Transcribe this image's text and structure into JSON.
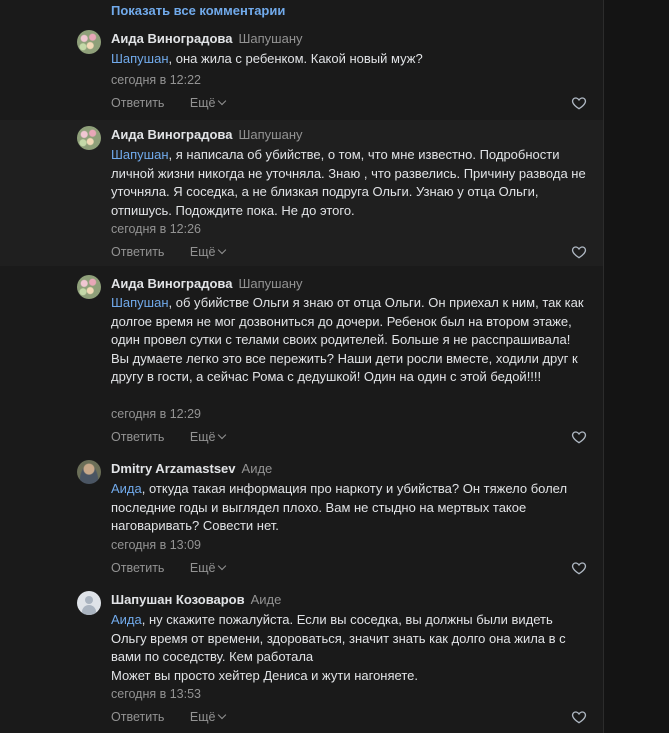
{
  "show_all_label": "Показать все комментарии",
  "actions": {
    "reply": "Ответить",
    "more": "Ещё"
  },
  "comments": [
    {
      "author": "Аида Виноградова",
      "reply_to": "Шапушану",
      "mention": "Шапушан",
      "text": ", она жила с ребенком. Какой новый муж?",
      "time": "сегодня в 12:22"
    },
    {
      "author": "Аида Виноградова",
      "reply_to": "Шапушану",
      "mention": "Шапушан",
      "text": ", я написала об убийстве, о том, что мне известно. Подробности личной жизни никогда не уточняла. Знаю , что развелись. Причину развода не уточняла. Я соседка, а не близкая подруга Ольги. Узнаю у отца Ольги, отпишусь. Подождите пока. Не до этого.",
      "time": "сегодня в 12:26"
    },
    {
      "author": "Аида Виноградова",
      "reply_to": "Шапушану",
      "mention": "Шапушан",
      "text": ", об убийстве Ольги я знаю от отца Ольги. Он приехал к ним, так как долгое время не мог дозвониться до дочери. Ребенок был на втором этаже, один провел сутки с телами своих родителей. Больше я не расспрашивала! Вы думаете легко это все пережить? Наши дети росли вместе, ходили друг к другу в гости, а сейчас Рома с дедушкой! Один на один с этой бедой!!!!",
      "time": "сегодня в 12:29"
    },
    {
      "author": "Dmitry Arzamastsev",
      "reply_to": "Аиде",
      "mention": "Аида",
      "text": ", откуда такая информация про наркоту и убийства? Он тяжело болел последние годы и выглядел плохо. Вам не стыдно на мертвых такое наговаривать? Совести нет.",
      "time": "сегодня в 13:09"
    },
    {
      "author": "Шапушан Козоваров",
      "reply_to": "Аиде",
      "mention": "Аида",
      "text": ", ну скажите пожалуйста. Если вы соседка, вы должны были видеть Ольгу время от времени, здороваться, значит знать как долго она жила в с вами по соседству. Кем работала",
      "text_line2": "Может вы просто хейтер Дениса и жути нагоняете.",
      "time": "сегодня в 13:53"
    }
  ]
}
